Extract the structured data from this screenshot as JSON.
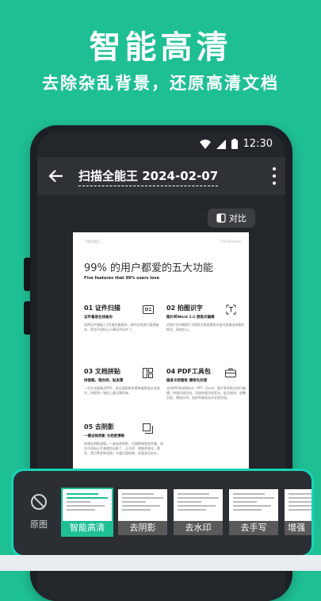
{
  "promo": {
    "title": "智能高清",
    "subtitle": "去除杂乱背景，还原高清文档"
  },
  "status_bar": {
    "time": "12:30"
  },
  "app_bar": {
    "title": "扫描全能王 2024-02-07"
  },
  "compare_button": {
    "label": "对比"
  },
  "document": {
    "header_left": "扫描全能王",
    "header_right": "CamScanner",
    "title": "99% 的用户都爱的五大功能",
    "subtitle": "Five features that 99% users love",
    "features": [
      {
        "title": "01 证件扫描",
        "subtitle": "证件着录在线备份",
        "desc": "选择证件模板1:1扫描完美复刻，高时在线进行管理备份，再也不用担心小事证件证件了。"
      },
      {
        "title": "02 拍图识字",
        "subtitle": "图片转Word 1:1 原版式编辑",
        "desc": "对照片任何概转1:1原版式提速提取文档内容输出原要的格式，高效办公。"
      },
      {
        "title": "03 文档拼贴",
        "subtitle": "拼接图，理合同，贴发票",
        "desc": "一次生成图像及PDF，发证面相拼发票单据拼接全选排列，拼接到一张纸上重点事项来。"
      },
      {
        "title": "04 PDF工具包",
        "subtitle": "随身文档管家 康密名处理",
        "desc": "支持PDF转成Word、PPT、Excel、图片等多格式进行编辑，快速扫描文档，试接快速添加签名、批注修改、调整页面、增加水印，轻松驾驶驱动开处理文档。"
      },
      {
        "title": "05 去阴影",
        "subtitle": "一键去除阴影 文档更清晰",
        "desc": "新增去阴影滤镜，一键去除阴影，扫描简单更加完美，再也不用担心手拿遮挡光影了。企业项：增强并锐化，擦亮，黑白等多种滤镜，丰富扫描效果，快速多任务办。"
      }
    ]
  },
  "filters": {
    "original_label": "原图",
    "items": [
      {
        "label": "智能高清",
        "selected": true
      },
      {
        "label": "去阴影",
        "selected": false
      },
      {
        "label": "去水印",
        "selected": false
      },
      {
        "label": "去手写",
        "selected": false
      },
      {
        "label": "增强",
        "selected": false
      }
    ]
  },
  "colors": {
    "brand": "#1fbf94",
    "accent_border": "#19d3b6"
  }
}
